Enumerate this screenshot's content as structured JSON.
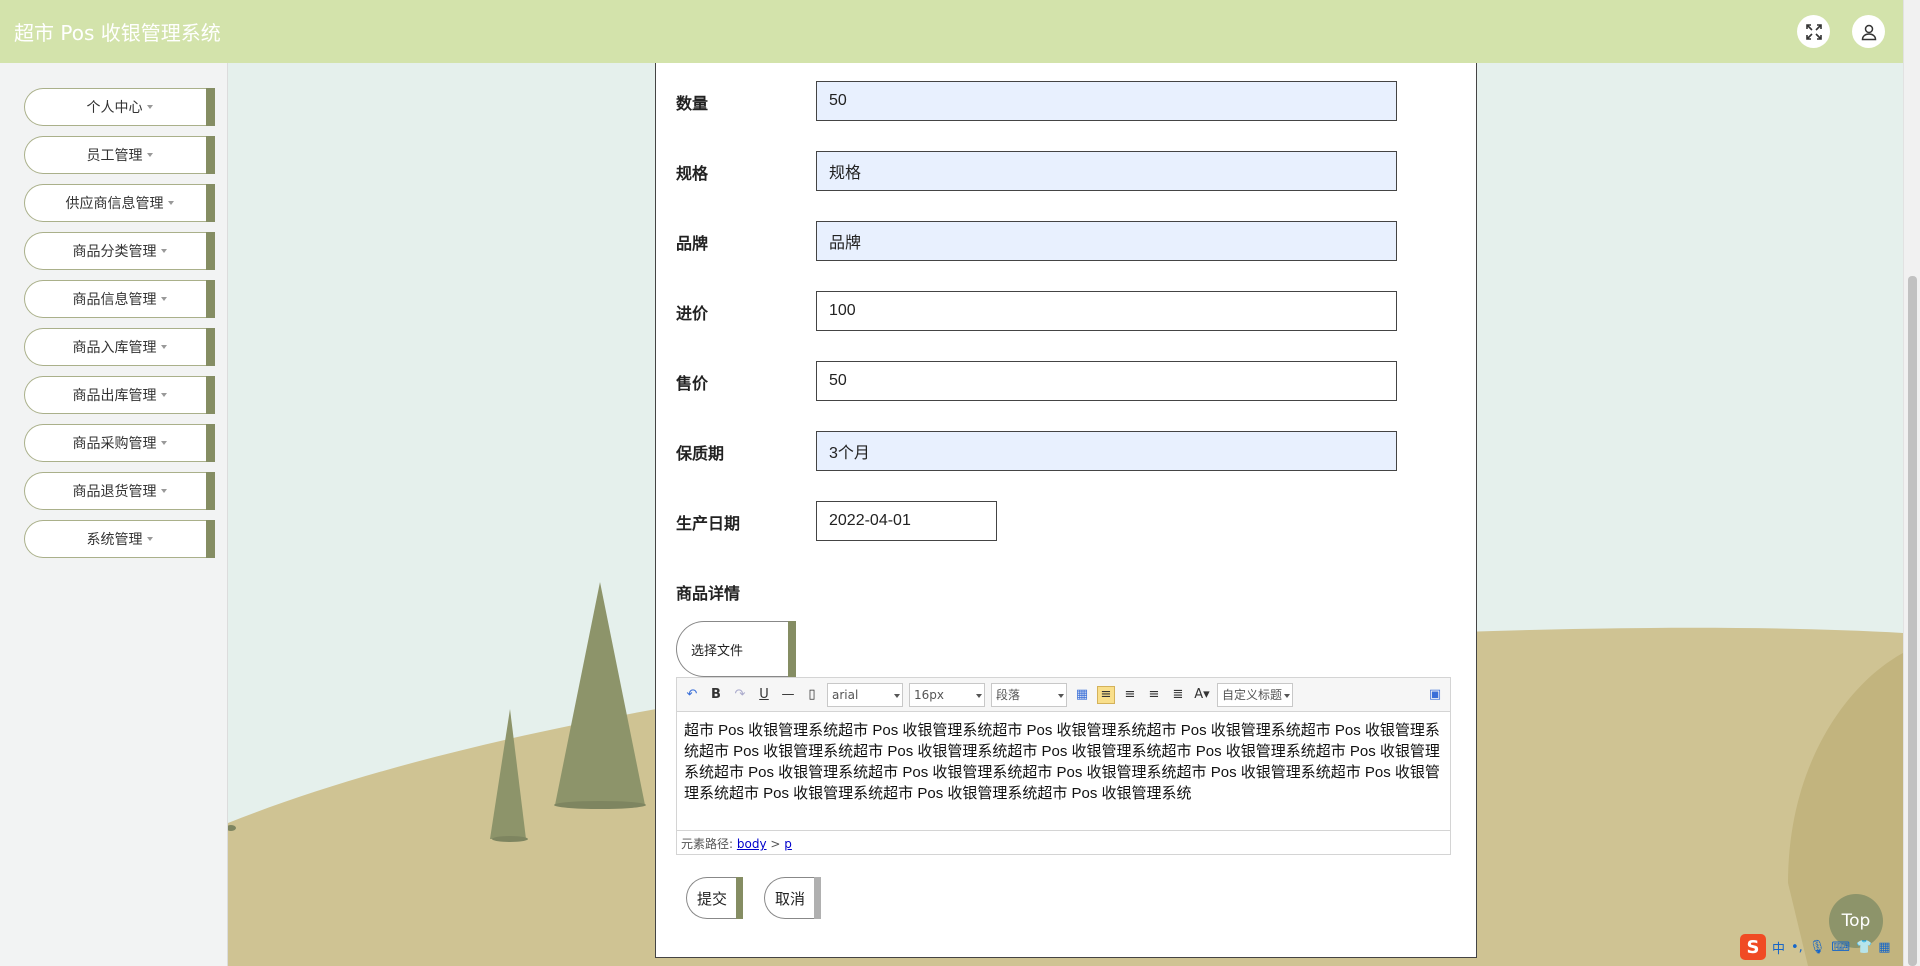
{
  "header": {
    "title": "超市 Pos 收银管理系统",
    "fullscreen_icon": "fullscreen-icon",
    "user_icon": "user-icon"
  },
  "sidebar": {
    "items": [
      {
        "label": "个人中心"
      },
      {
        "label": "员工管理"
      },
      {
        "label": "供应商信息管理"
      },
      {
        "label": "商品分类管理"
      },
      {
        "label": "商品信息管理"
      },
      {
        "label": "商品入库管理"
      },
      {
        "label": "商品出库管理"
      },
      {
        "label": "商品采购管理"
      },
      {
        "label": "商品退货管理"
      },
      {
        "label": "系统管理"
      }
    ]
  },
  "form": {
    "quantity": {
      "label": "数量",
      "value": "50"
    },
    "spec": {
      "label": "规格",
      "placeholder": "规格"
    },
    "brand": {
      "label": "品牌",
      "placeholder": "品牌"
    },
    "cost_price": {
      "label": "进价",
      "value": "100"
    },
    "sale_price": {
      "label": "售价",
      "value": "50"
    },
    "shelf_life": {
      "label": "保质期",
      "value": "3个月"
    },
    "production_date": {
      "label": "生产日期",
      "value": "2022-04-01"
    },
    "details": {
      "label": "商品详情"
    },
    "file_button": "选择文件",
    "submit": "提交",
    "cancel": "取消"
  },
  "editor": {
    "font_family": "arial",
    "font_size": "16px",
    "paragraph": "段落",
    "custom_title": "自定义标题",
    "content": "超市 Pos 收银管理系统超市 Pos 收银管理系统超市 Pos 收银管理系统超市 Pos 收银管理系统超市 Pos 收银管理系统超市 Pos 收银管理系统超市 Pos 收银管理系统超市 Pos 收银管理系统超市 Pos 收银管理系统超市 Pos 收银管理系统超市 Pos 收银管理系统超市 Pos 收银管理系统超市 Pos 收银管理系统超市 Pos 收银管理系统超市 Pos 收银管理系统超市 Pos 收银管理系统超市 Pos 收银管理系统超市 Pos 收银管理系统",
    "path_label": "元素路径:",
    "path_body": "body",
    "path_sep": ">",
    "path_p": "p"
  },
  "top_button": "Top",
  "ime": {
    "lang": "中"
  },
  "colors": {
    "header": "#d3e3ab",
    "accent": "#858d63",
    "field_shaded": "#e8f0fe",
    "background": "#e5f0ec"
  }
}
